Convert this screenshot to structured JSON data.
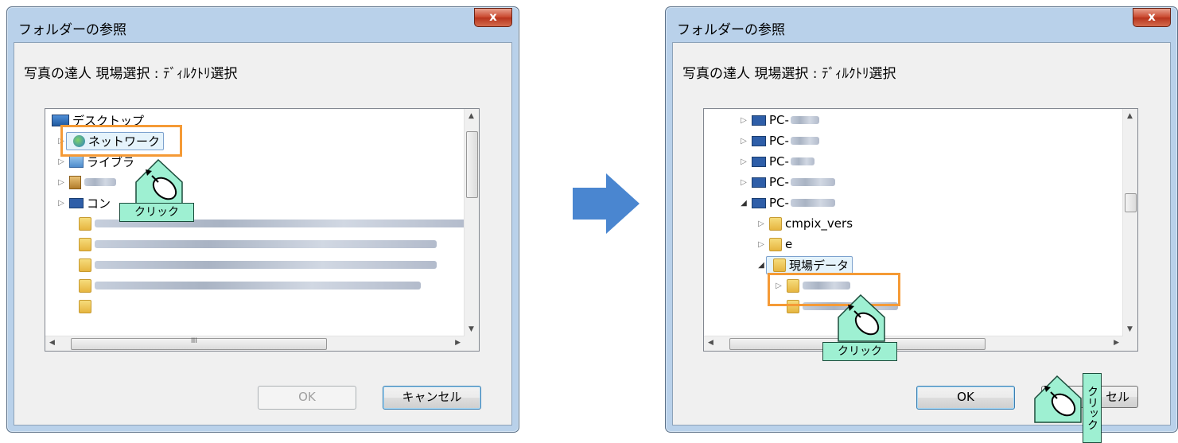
{
  "dialog1": {
    "title": "フォルダーの参照",
    "close_glyph": "x",
    "prompt": "写真の達人 現場選択 : ﾃﾞｨﾙｸﾄﾘ選択",
    "tree": [
      {
        "label": "デスクトップ",
        "icon": "desktop-icon"
      },
      {
        "label": "ネットワーク",
        "icon": "network-icon"
      },
      {
        "label": "ライブラ",
        "icon": "library-icon"
      },
      {
        "label": "",
        "icon": "user-folder-icon"
      },
      {
        "label": "コン",
        "icon": "computer-icon"
      }
    ],
    "ok_label": "OK",
    "cancel_label": "キャンセル",
    "hscroll_thumb_glyph": "III",
    "click_label": "クリック"
  },
  "dialog2": {
    "title": "フォルダーの参照",
    "close_glyph": "x",
    "prompt": "写真の達人 現場選択 : ﾃﾞｨﾙｸﾄﾘ選択",
    "tree": [
      {
        "label": "PC-",
        "icon": "computer-icon"
      },
      {
        "label": "PC-",
        "icon": "computer-icon"
      },
      {
        "label": "PC-",
        "icon": "computer-icon"
      },
      {
        "label": "PC-",
        "icon": "computer-icon"
      },
      {
        "label": "PC-",
        "icon": "computer-icon"
      },
      {
        "label": "cmpix_vers",
        "icon": "folder-icon"
      },
      {
        "label": "e",
        "icon": "folder-icon"
      },
      {
        "label": "現場データ",
        "icon": "folder-icon"
      }
    ],
    "ok_label": "OK",
    "cancel_label": "セル",
    "click_label_tree": "クリック",
    "click_label_ok": "クリック"
  },
  "colors": {
    "highlight": "#f59a36",
    "click_badge": "#9ef0d2",
    "big_arrow": "#4a86d0"
  }
}
